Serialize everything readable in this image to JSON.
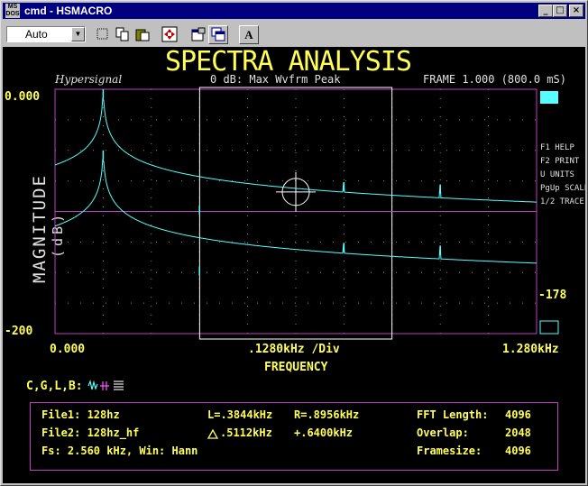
{
  "window": {
    "title": "cmd - HSMACRO",
    "app_icon_text": "MS DOS",
    "controls": {
      "minimize": "_",
      "maximize": "□",
      "close": "×"
    }
  },
  "toolbar": {
    "font_combo_value": "Auto",
    "font_button_label": "A",
    "buttons": [
      "mark-icon",
      "copy-icon",
      "paste-icon",
      "fullscreen-icon",
      "properties-icon",
      "background-icon",
      "font-icon"
    ]
  },
  "header": {
    "title": "SPECTRA ANALYSIS",
    "brand": "Hypersignal",
    "reference": "0 dB: Max Wvfrm Peak",
    "frame": "FRAME 1.000 (800.0 mS)"
  },
  "axes": {
    "y_top": "0.000",
    "y_bottom": "-200",
    "y_label": "MAGNITUDE",
    "y_unit": "(dB)",
    "x_start": "0.000",
    "x_div": ".1280kHz /Div",
    "x_end": "1.280kHz",
    "x_label": "FREQUENCY",
    "right_value": "-178"
  },
  "help": {
    "f1": "F1 HELP",
    "f2": "F2 PRINT",
    "u": "U UNITS",
    "pgup": "PgUp SCALE",
    "trace": "1/2 TRACE"
  },
  "mode_line": {
    "label": "C,G,L,B:"
  },
  "info": {
    "file1": "File1: 128hz",
    "file2": "File2: 128hz_hf",
    "fs": "Fs: 2.560 kHz, Win: Hann",
    "left": "L=.3844kHz",
    "right": "R=.8956kHz",
    "delta": ".5112kHz",
    "plus": "+.6400kHz",
    "fft_label": "FFT Length:",
    "fft_value": "4096",
    "overlap_label": "Overlap:",
    "overlap_value": "2048",
    "framesize_label": "Framesize:",
    "framesize_value": "4096"
  },
  "colors": {
    "background": "#000000",
    "trace": "#55ffff",
    "text": "#ffff55",
    "grid": "#8a8a8a",
    "frame": "#c040c0",
    "title_bar": "#000080"
  },
  "chart_data": {
    "type": "line",
    "x_range_khz": [
      0,
      1.28
    ],
    "x_div_khz": 0.128,
    "y_range_db": [
      -200,
      0
    ],
    "cursor_left_khz": 0.3844,
    "cursor_right_khz": 0.8956,
    "traces": [
      {
        "peaks_khz": [
          0.128,
          0.384,
          0.768,
          1.024
        ],
        "peak_db": [
          0,
          -95,
          -76,
          -78
        ]
      },
      {
        "peaks_khz": [
          0.128,
          0.384,
          0.768,
          1.024
        ],
        "peak_db": [
          -50,
          -145,
          -126,
          -128
        ]
      }
    ]
  }
}
